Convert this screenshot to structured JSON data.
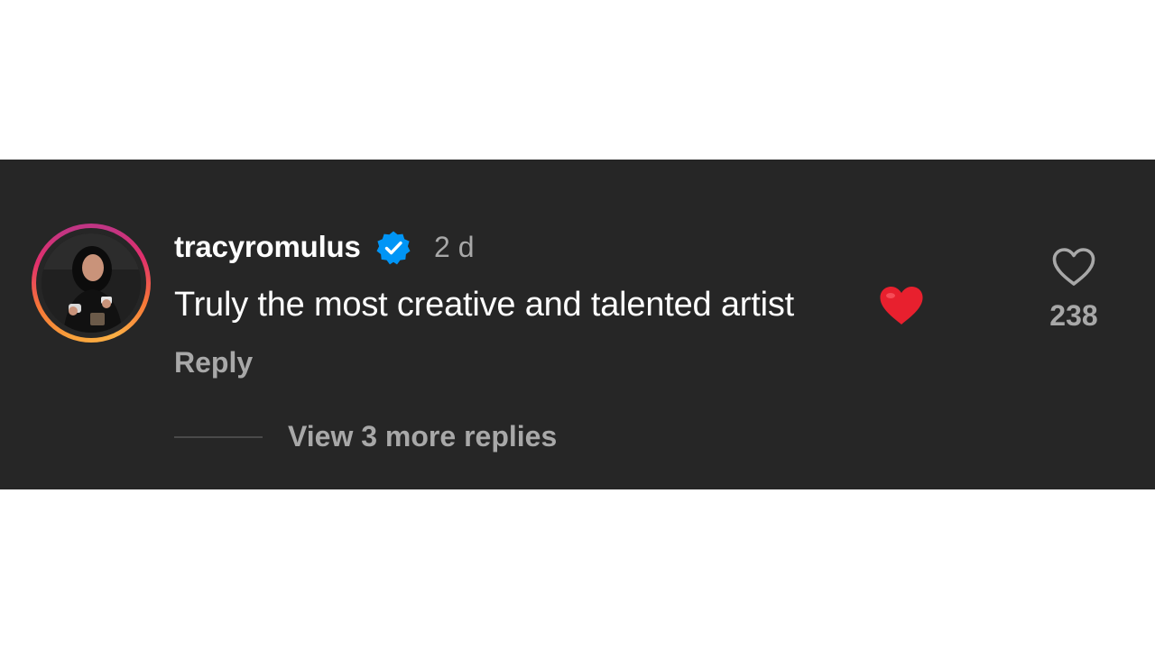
{
  "comment": {
    "username": "tracyromulus",
    "verified": true,
    "timestamp": "2 d",
    "text": "Truly the most creative and talented artist",
    "emoji": "red-heart",
    "reply_label": "Reply",
    "like_count": "238",
    "view_replies_label": "View 3 more replies"
  },
  "colors": {
    "card_background": "#262626",
    "verified_badge": "#0095f6",
    "muted_text": "#a8a8a8",
    "heart_emoji": "#e8202e"
  },
  "icons": {
    "verified": "verified-badge-icon",
    "like": "heart-outline-icon",
    "emoji": "red-heart-emoji-icon"
  }
}
